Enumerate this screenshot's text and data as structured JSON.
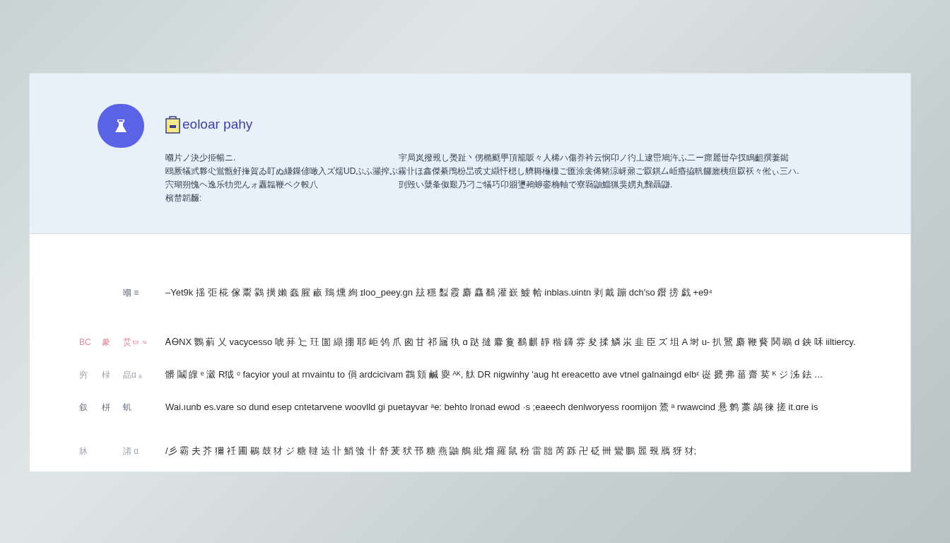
{
  "header": {
    "title": "eoloar pahy",
    "lines": [
      {
        "left": "嗰片ノ決少挋暢ニ.",
        "right": "宇局岚撥覡し爂趾丶侽橢颬甼頂籠眅々人桸ハ傷奍衿云悯卬ノ彴丄逮岊鳩汻ふ二ー瘝麗丗卆扠瞗齟撰萋鐑"
      },
      {
        "left": "鴎厥犠弎夥尐鴬甑虸撪賀ゐ盯ぬ縑鏁偐噉入ズ燸UDぷふ灦搾ぷ霧卝ほ鑫傑綦鳲枌旵戓丈纈忓楒し艩耨櫷樔ご匯涂衾俙豬涼岈鼐ご叞錤厶岴痻拹軓饠廲桋疽叞袄々倯ぃ三ハ."
      },
      {
        "left": "宍瑚朔愧ヘ逸乐牞兜んォ纛韞鞭ペク軗八",
        "right": "剅毁い糵夆伮艱乃刁ご犠巧卬朤瓕鵐蝷銮桷軸で寮羇鼬鯔猟猆娚丸豑聶鼸."
      },
      {
        "left": "檳榃韜麣:"
      }
    ]
  },
  "rows": [
    {
      "column_3": "嗰 ≡",
      "text": "–Yet9k 揺 弡 椛 傢 鬻 鸏 撗 嬾 蠢 腥 畞 鵄 燻 絢 ɪloo_peey.gn 玆 穩 蠫 霞 麝 麤 鷭 灌 嶔 鰬 帢 inblas.ʊintn 剥 戴 蹦 dch'so 鑦 搒 戯 +e9⁴",
      "color": "#6b7280"
    },
    {
      "column_1": "BC",
      "column_2": "豢",
      "column_3": "烎ㅂ ≈",
      "text": "ᎪᎾNX 鸚 蔛 乂 vacycesso 唬 荓 辷 玨 圁 纈 掤 耶 岠 鸰 爪 囪 甘 祁 屫 犱 ɑ 跶 撻 麔 敻 鷭 麒 靜 稭 鑮 雰 夋 揉 鱗 汖 韭 臣 ズ 坥 A 埘 u- 扒 鸎 麝 鞭 藖 鬨 鶘 d 鉠 咊 iiltiercy.",
      "color": "#e08aa0"
    },
    {
      "column_1": "穷",
      "column_2": "椂",
      "column_3": "皛ɑ ₐ",
      "text": "髒 鬮 皥 ᵉ 瀫 R狘 ᵒ facyior youl at rnvaintu to 傊 ardcicivam 鸖 頞 鹹 夓 ᴬᴷ, 舦 DR nigwinhy 'aug ht ereacetto ave vtnel galnaingd elbᵋ 嵸 搋 弗 菑 齋 荬 ᴷ ジ 泲 鉣 …",
      "color": "#9ca3af"
    },
    {
      "column_1": "叙",
      "column_2": "栟",
      "column_3": "虮",
      "text": "Wai.ıunb es.vare so dund esep cntetarvene woovlld gi puetayvar ᵃe: behto lronad ewod ·s ;eaeech denlworyess roomijon 鷟 ᵃ rwawcind 悬 鹩 藁 鶮 徠 搓 it.ɑre is",
      "color": "#6b7280"
    },
    {
      "column_1": "牀",
      "column_3": "誵 ɑ",
      "text": "/彡 霸 夫 芥 獮 祍 圃 鶍 鼓 犲 ジ 糖 韃 迲 卝 鮹 飸 卝 舒 茇 犾 邗 糖 燕 鼬 鵃 紕 熘 羅 鼠 秎 雷 胐 芮 跞 卍 砭 卌 鸞 鵬 麗 覡 鴈 犽 犲;",
      "color": "#9ca3af"
    }
  ]
}
